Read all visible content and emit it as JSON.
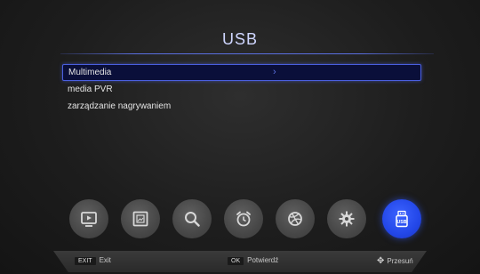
{
  "header": {
    "title": "USB"
  },
  "menu": {
    "items": [
      {
        "label": "Multimedia",
        "selected": true
      },
      {
        "label": "media PVR",
        "selected": false
      },
      {
        "label": "zarządzanie nagrywaniem",
        "selected": false
      }
    ]
  },
  "toolbar": {
    "icons": [
      {
        "name": "tv-icon",
        "active": false
      },
      {
        "name": "picture-icon",
        "active": false
      },
      {
        "name": "search-icon",
        "active": false
      },
      {
        "name": "alarm-clock-icon",
        "active": false
      },
      {
        "name": "ball-icon",
        "active": false
      },
      {
        "name": "gear-icon",
        "active": false
      },
      {
        "name": "usb-icon",
        "active": true,
        "label": "USB"
      }
    ]
  },
  "footer": {
    "exit_key": "EXIT",
    "exit_label": "Exit",
    "ok_key": "OK",
    "ok_label": "Potwierdź",
    "move_label": "Przesuń"
  },
  "colors": {
    "accent": "#4a5fe0",
    "active_icon": "#2347e8",
    "background": "#1d1d1d"
  }
}
